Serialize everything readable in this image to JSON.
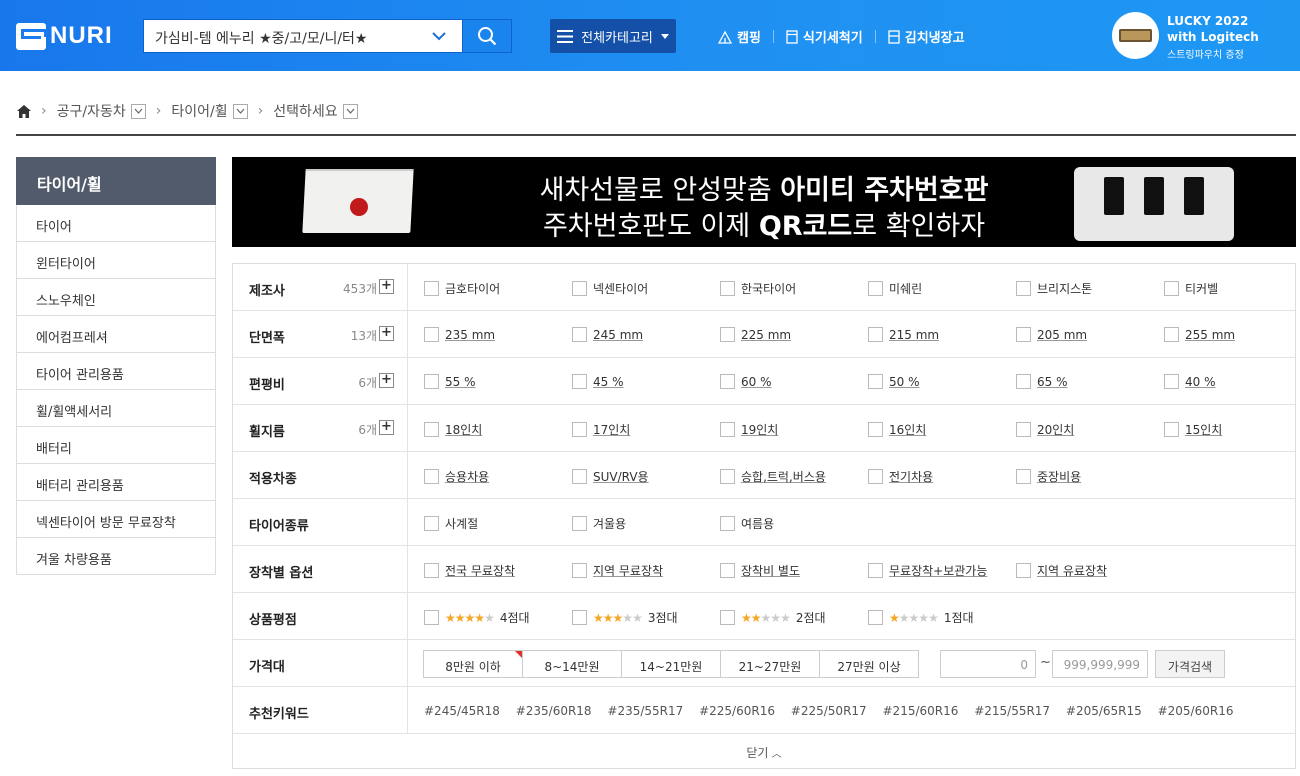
{
  "header": {
    "logo": "NURI",
    "search_value": "가심비-템 에누리 ★중/고/모/니/터★",
    "category_button": "전체카테고리",
    "quick_links": [
      "캠핑",
      "식기세척기",
      "김치냉장고"
    ],
    "promo": {
      "line1": "LUCKY 2022",
      "line2": "with Logitech",
      "line3": "스트링파우치 증정"
    }
  },
  "breadcrumb": [
    "공구/자동차",
    "타이어/휠",
    "선택하세요"
  ],
  "sidebar": {
    "title": "타이어/휠",
    "items": [
      "타이어",
      "윈터타이어",
      "스노우체인",
      "에어컴프레셔",
      "타이어 관리용품",
      "휠/휠액세서리",
      "배터리",
      "배터리 관리용품",
      "넥센타이어 방문 무료장착",
      "겨울 차량용품"
    ]
  },
  "banner": {
    "line1_pre": "새차선물로 안성맞춤 ",
    "line1_bold": "아미티 주차번호판",
    "line2_pre": "주차번호판도 이제 ",
    "line2_bold": "QR코드",
    "line2_post": "로 확인하자"
  },
  "filters": [
    {
      "label": "제조사",
      "count": "453개",
      "options": [
        "금호타이어",
        "넥센타이어",
        "한국타이어",
        "미쉐린",
        "브리지스톤",
        "티커벨"
      ],
      "underline": false
    },
    {
      "label": "단면폭",
      "count": "13개",
      "options": [
        "235 mm",
        "245 mm",
        "225 mm",
        "215 mm",
        "205 mm",
        "255 mm"
      ],
      "underline": true
    },
    {
      "label": "편평비",
      "count": "6개",
      "options": [
        "55 %",
        "45 %",
        "60 %",
        "50 %",
        "65 %",
        "40 %"
      ],
      "underline": true
    },
    {
      "label": "휠지름",
      "count": "6개",
      "options": [
        "18인치",
        "17인치",
        "19인치",
        "16인치",
        "20인치",
        "15인치"
      ],
      "underline": true
    },
    {
      "label": "적용차종",
      "count": "",
      "options": [
        "승용차용",
        "SUV/RV용",
        "승합,트럭,버스용",
        "전기차용",
        "중장비용"
      ],
      "underline": true
    },
    {
      "label": "타이어종류",
      "count": "",
      "options": [
        "사계절",
        "겨울용",
        "여름용"
      ],
      "underline": false
    },
    {
      "label": "장착별 옵션",
      "count": "",
      "options": [
        "전국 무료장착",
        "지역 무료장착",
        "장착비 별도",
        "무료장착+보관가능",
        "지역 유료장착"
      ],
      "underline": true
    }
  ],
  "rating": {
    "label": "상품평점",
    "options": [
      {
        "stars": 4,
        "text": "4점대"
      },
      {
        "stars": 3,
        "text": "3점대"
      },
      {
        "stars": 2,
        "text": "2점대"
      },
      {
        "stars": 1,
        "text": "1점대"
      }
    ]
  },
  "price": {
    "label": "가격대",
    "ranges": [
      "8만원 이하",
      "8~14만원",
      "14~21만원",
      "21~27만원",
      "27만원 이상"
    ],
    "min_placeholder": "0",
    "max_placeholder": "999,999,999",
    "search_label": "가격검색"
  },
  "keywords": {
    "label": "추천키워드",
    "items": [
      "#245/45R18",
      "#235/60R18",
      "#235/55R17",
      "#225/60R16",
      "#225/50R17",
      "#215/60R16",
      "#215/55R17",
      "#205/65R15",
      "#205/60R16"
    ]
  },
  "close_label": "닫기"
}
